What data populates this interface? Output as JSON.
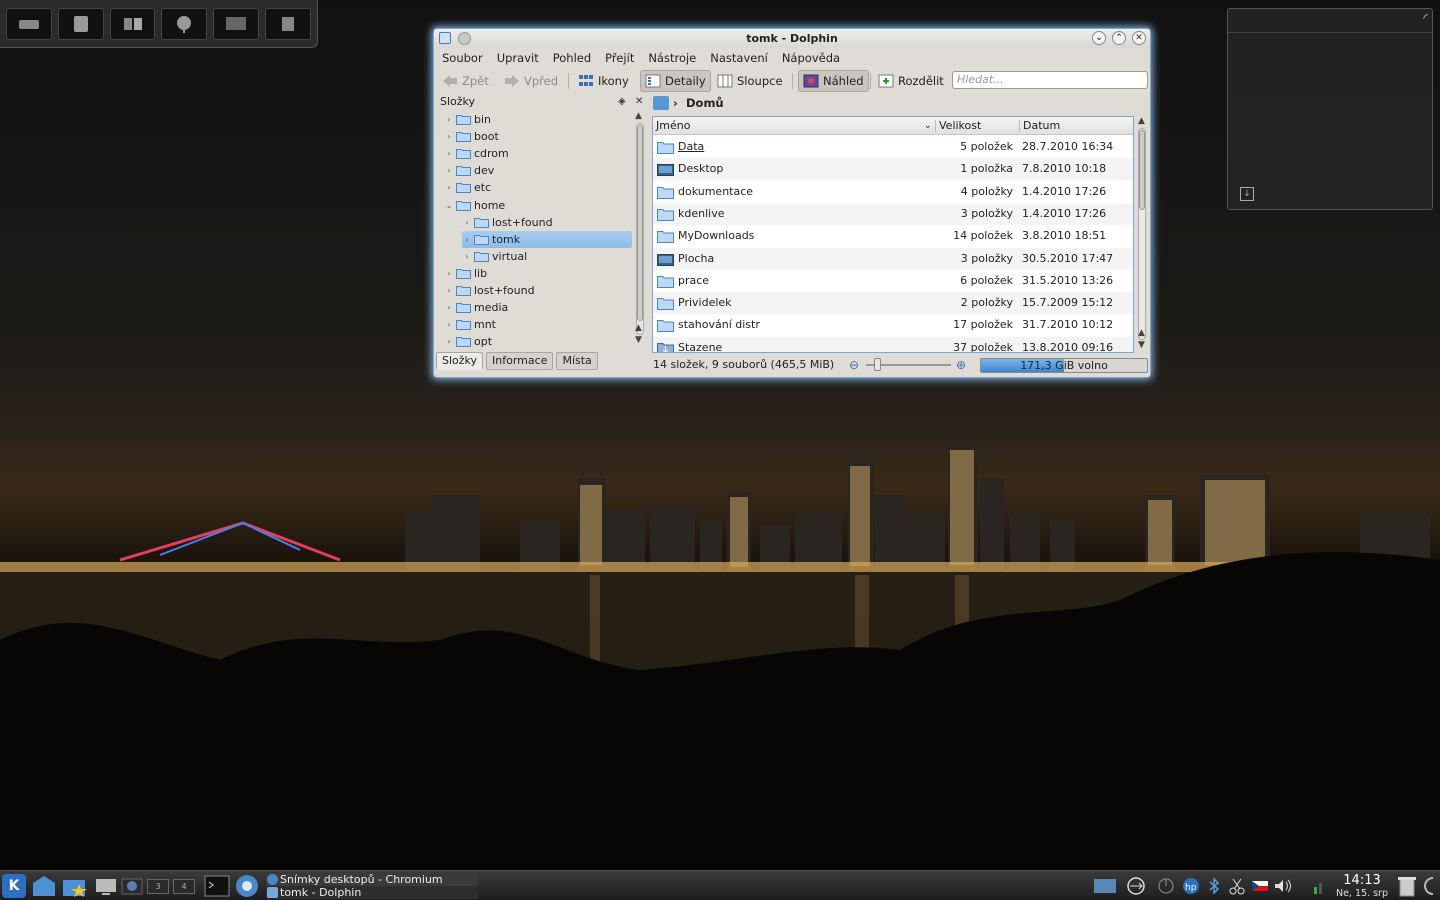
{
  "window": {
    "title": "tomk - Dolphin"
  },
  "menubar": [
    "Soubor",
    "Upravit",
    "Pohled",
    "Přejít",
    "Nástroje",
    "Nastavení",
    "Nápověda"
  ],
  "toolbar": {
    "back": "Zpět",
    "forward": "Vpřed",
    "icons": "Ikony",
    "details": "Detaily",
    "columns": "Sloupce",
    "preview": "Náhled",
    "split": "Rozdělit",
    "search_placeholder": "Hledat..."
  },
  "panel": {
    "title": "Složky",
    "tree": [
      {
        "label": "bin",
        "level": 0,
        "expanded": false,
        "selected": false
      },
      {
        "label": "boot",
        "level": 0,
        "expanded": false,
        "selected": false
      },
      {
        "label": "cdrom",
        "level": 0,
        "expanded": false,
        "selected": false
      },
      {
        "label": "dev",
        "level": 0,
        "expanded": false,
        "selected": false
      },
      {
        "label": "etc",
        "level": 0,
        "expanded": false,
        "selected": false
      },
      {
        "label": "home",
        "level": 0,
        "expanded": true,
        "selected": false
      },
      {
        "label": "lost+found",
        "level": 1,
        "expanded": false,
        "selected": false
      },
      {
        "label": "tomk",
        "level": 1,
        "expanded": false,
        "selected": true
      },
      {
        "label": "virtual",
        "level": 1,
        "expanded": false,
        "selected": false
      },
      {
        "label": "lib",
        "level": 0,
        "expanded": false,
        "selected": false
      },
      {
        "label": "lost+found",
        "level": 0,
        "expanded": false,
        "selected": false
      },
      {
        "label": "media",
        "level": 0,
        "expanded": false,
        "selected": false
      },
      {
        "label": "mnt",
        "level": 0,
        "expanded": false,
        "selected": false
      },
      {
        "label": "opt",
        "level": 0,
        "expanded": false,
        "selected": false
      }
    ],
    "tabs": [
      "Složky",
      "Informace",
      "Místa"
    ]
  },
  "location": {
    "crumb": "Domů"
  },
  "filelist": {
    "columns": {
      "name": "Jméno",
      "size": "Velikost",
      "date": "Datum"
    },
    "rows": [
      {
        "name": "Data",
        "size": "5 položek",
        "date": "28.7.2010 16:34",
        "icon": "folder-icon"
      },
      {
        "name": "Desktop",
        "size": "1 položka",
        "date": "7.8.2010 10:18",
        "icon": "desktop-folder-icon"
      },
      {
        "name": "dokumentace",
        "size": "4 položky",
        "date": "1.4.2010 17:26",
        "icon": "folder-icon"
      },
      {
        "name": "kdenlive",
        "size": "3 položky",
        "date": "1.4.2010 17:26",
        "icon": "folder-icon"
      },
      {
        "name": "MyDownloads",
        "size": "14 položek",
        "date": "3.8.2010 18:51",
        "icon": "folder-icon"
      },
      {
        "name": "Plocha",
        "size": "3 položky",
        "date": "30.5.2010 17:47",
        "icon": "desktop-folder-icon"
      },
      {
        "name": "prace",
        "size": "6 položek",
        "date": "31.5.2010 13:26",
        "icon": "folder-icon"
      },
      {
        "name": "Prividelek",
        "size": "2 položky",
        "date": "15.7.2009 15:12",
        "icon": "folder-icon"
      },
      {
        "name": "stahování distr",
        "size": "17 položek",
        "date": "31.7.2010 10:12",
        "icon": "folder-icon"
      },
      {
        "name": "Stazene",
        "size": "37 položek",
        "date": "13.8.2010 09:16",
        "icon": "download-folder-icon"
      }
    ]
  },
  "status": {
    "text": "14 složek, 9 souborů (465,5 MiB)",
    "free_space": "171,3 GiB volno",
    "used_fraction": 0.5
  },
  "taskbar": {
    "kicker_label": "K",
    "pager": [
      "3",
      "4"
    ],
    "tasks": [
      {
        "label": "Snímky desktopů - Chromium"
      },
      {
        "label": "tomk - Dolphin"
      }
    ],
    "clock_time": "14:13",
    "clock_date": "Ne, 15. srp"
  },
  "colors": {
    "accent": "#3c86d0",
    "selection": "#8fbbe8",
    "window_glow": "#8cbef0"
  }
}
